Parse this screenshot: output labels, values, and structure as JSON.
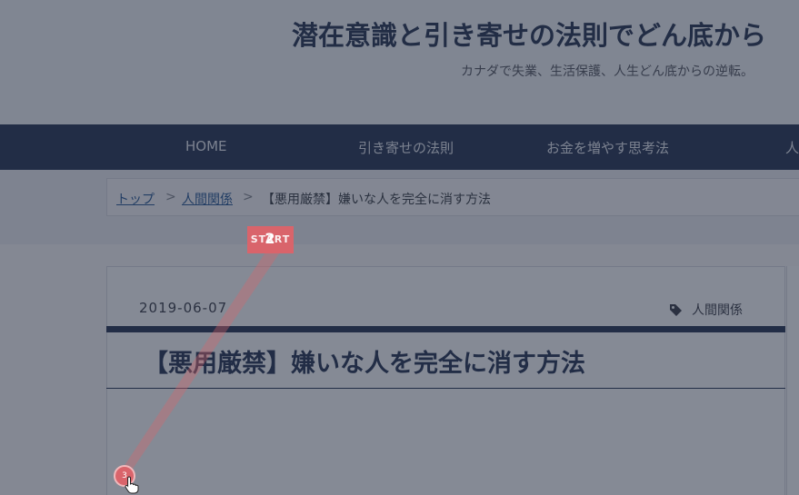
{
  "header": {
    "site_title": "潜在意識と引き寄せの法則でどん底から",
    "tagline": "カナダで失業、生活保護、人生どん底からの逆転。"
  },
  "nav": {
    "items": [
      {
        "label": "HOME"
      },
      {
        "label": "引き寄せの法則"
      },
      {
        "label": "お金を増やす思考法"
      },
      {
        "label": "人"
      }
    ]
  },
  "breadcrumb": {
    "items": [
      {
        "label": "トップ"
      },
      {
        "label": "人間関係"
      }
    ],
    "separator": ">",
    "current": "【悪用厳禁】嫌いな人を完全に消す方法"
  },
  "article": {
    "date": "2019-06-07",
    "tag": "人間関係",
    "tag_icon": "tag-icon",
    "title": "【悪用厳禁】嫌いな人を完全に消す方法"
  },
  "recording": {
    "start_label": "START",
    "step_number": "2",
    "click_number": "3",
    "accent_color": "#d9646b"
  }
}
